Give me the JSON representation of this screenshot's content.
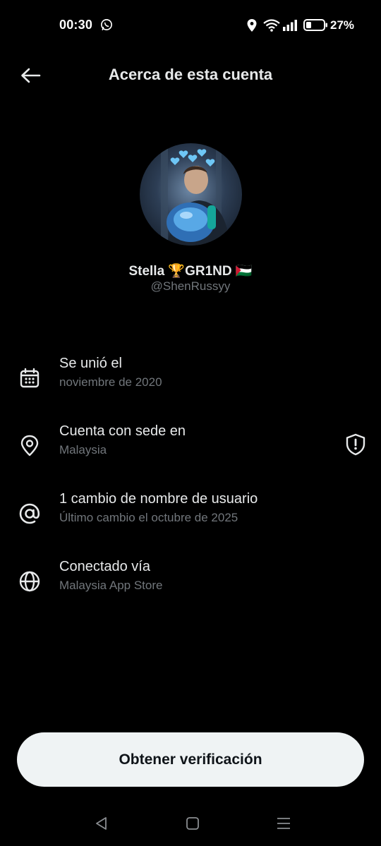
{
  "status_bar": {
    "time": "00:30",
    "battery": "27%",
    "icons": [
      "whatsapp-icon",
      "location-icon",
      "wifi-icon",
      "signal-icon",
      "battery-icon"
    ]
  },
  "header": {
    "title": "Acerca de esta cuenta",
    "back_icon": "arrow-left-icon"
  },
  "profile": {
    "name": "Stella 🏆GR1ND 🇵🇸",
    "handle": "@ShenRussyy"
  },
  "rows": [
    {
      "icon": "calendar-icon",
      "title": "Se unió el",
      "subtitle": "noviembre de 2020"
    },
    {
      "icon": "location-pin-icon",
      "title": "Cuenta con sede en",
      "subtitle": "Malaysia",
      "trailing_icon": "shield-alert-icon"
    },
    {
      "icon": "at-sign-icon",
      "title": "1 cambio de nombre de usuario",
      "subtitle": "Último cambio el octubre de 2025"
    },
    {
      "icon": "globe-icon",
      "title": "Conectado vía",
      "subtitle": "Malaysia App Store"
    }
  ],
  "footer": {
    "verify_label": "Obtener verificación"
  },
  "colors": {
    "background": "#000000",
    "primary_text": "#e7e9ea",
    "secondary_text": "#71767b",
    "button_bg": "#eff3f4",
    "button_text": "#0f1419"
  }
}
